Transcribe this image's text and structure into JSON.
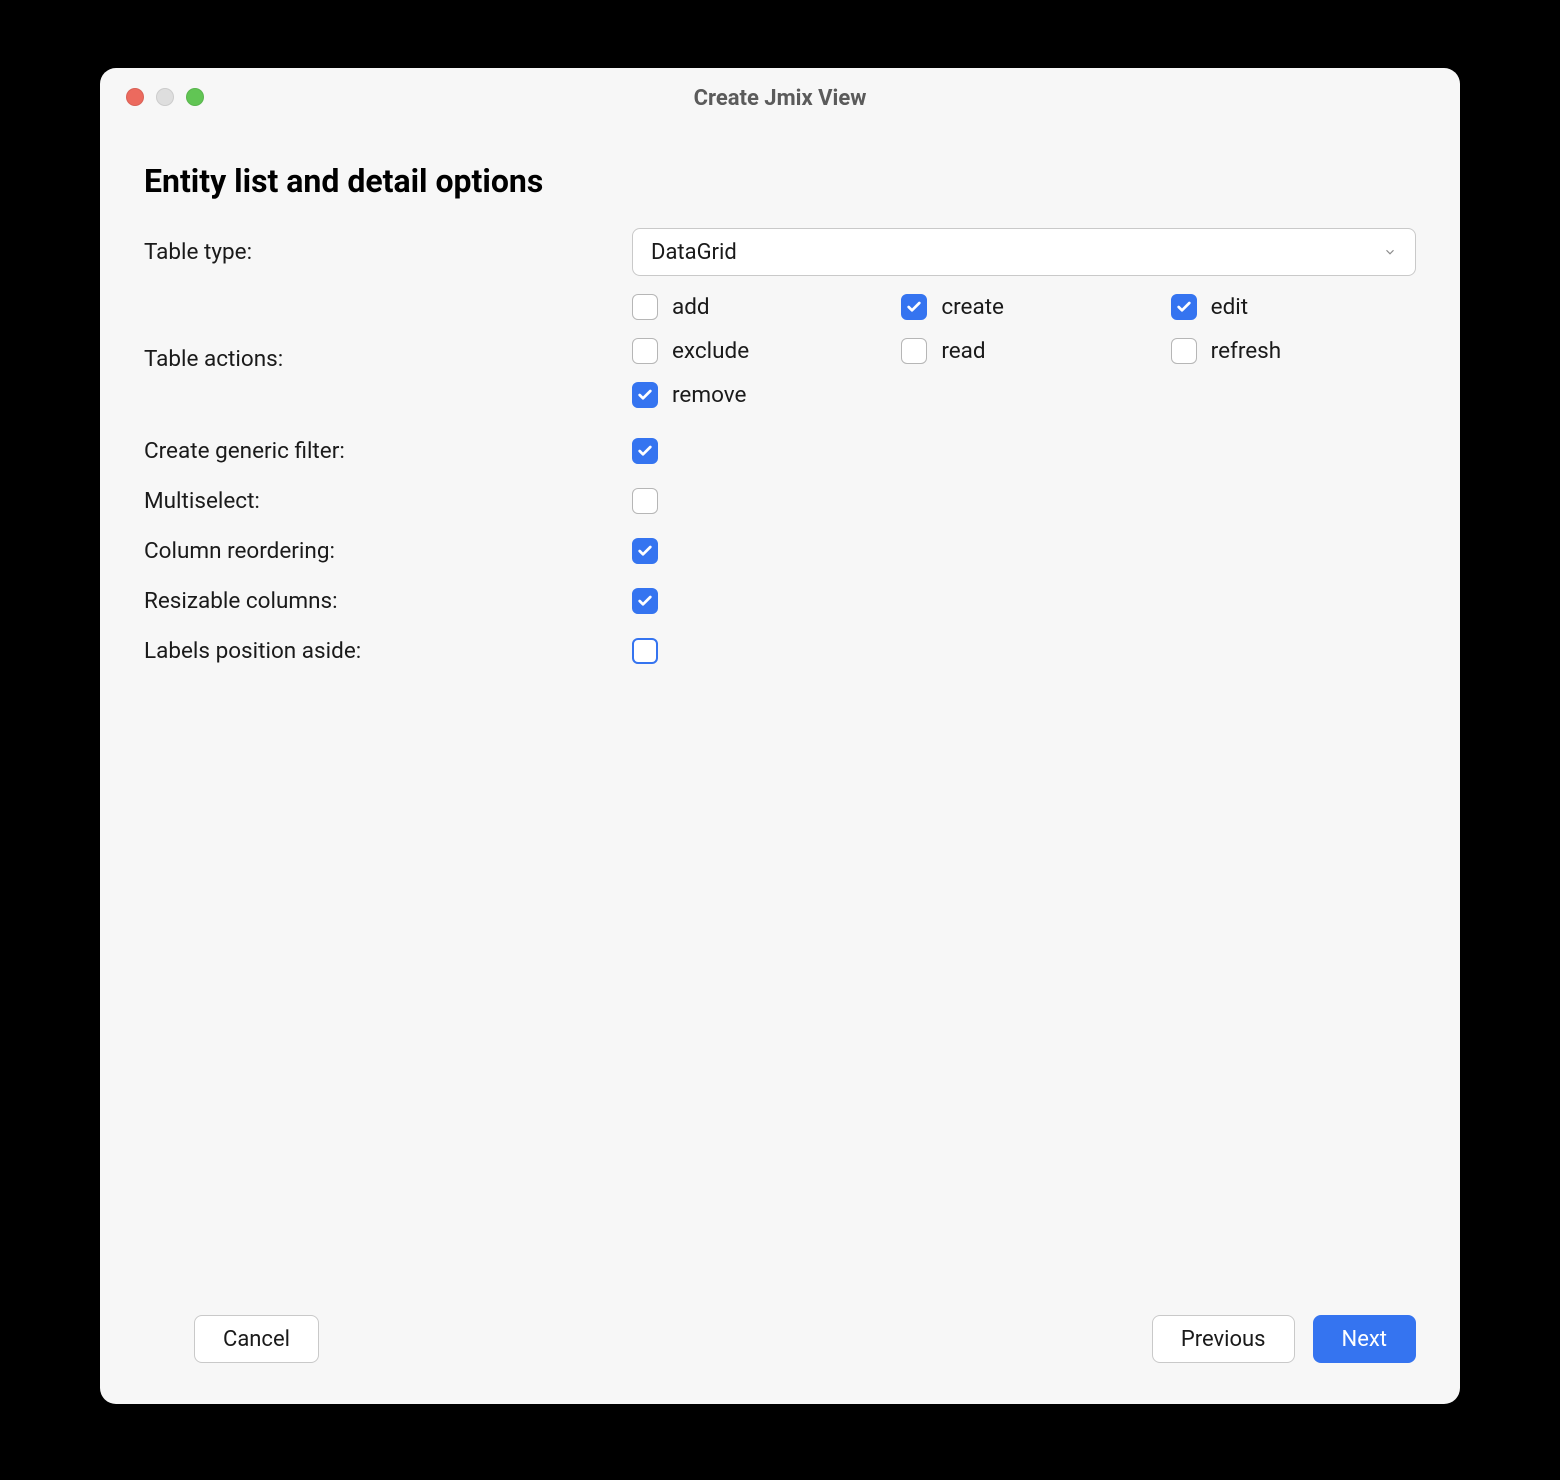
{
  "window": {
    "title": "Create Jmix View"
  },
  "page": {
    "title": "Entity list and detail options"
  },
  "form": {
    "table_type": {
      "label": "Table type:",
      "value": "DataGrid"
    },
    "table_actions": {
      "label": "Table actions:",
      "items": [
        {
          "label": "add",
          "checked": false
        },
        {
          "label": "create",
          "checked": true
        },
        {
          "label": "edit",
          "checked": true
        },
        {
          "label": "exclude",
          "checked": false
        },
        {
          "label": "read",
          "checked": false
        },
        {
          "label": "refresh",
          "checked": false
        },
        {
          "label": "remove",
          "checked": true
        }
      ]
    },
    "options": [
      {
        "label": "Create generic filter:",
        "checked": true,
        "focused": false
      },
      {
        "label": "Multiselect:",
        "checked": false,
        "focused": false
      },
      {
        "label": "Column reordering:",
        "checked": true,
        "focused": false
      },
      {
        "label": "Resizable columns:",
        "checked": true,
        "focused": false
      },
      {
        "label": "Labels position aside:",
        "checked": false,
        "focused": true
      }
    ]
  },
  "footer": {
    "cancel": "Cancel",
    "previous": "Previous",
    "next": "Next"
  }
}
